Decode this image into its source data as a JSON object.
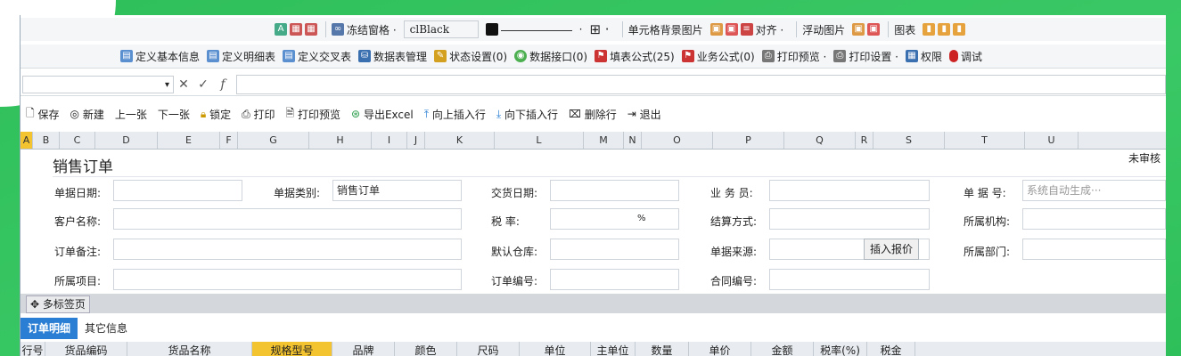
{
  "toolbar1": {
    "freeze_label": "冻结窗格 ·",
    "color_value": "clBlack",
    "cell_bg_label": "单元格背景图片",
    "align_label": "对齐 ·",
    "float_img_label": "浮动图片",
    "chart_label": "图表"
  },
  "toolbar2": {
    "items": [
      "定义基本信息",
      "定义明细表",
      "定义交叉表",
      "数据表管理",
      "状态设置(0)",
      "数据接口(0)",
      "填表公式(25)",
      "业务公式(0)",
      "打印预览 ·",
      "打印设置 ·",
      "权限",
      "调试"
    ]
  },
  "toolbar3": {
    "items": [
      "保存",
      "新建",
      "上一张",
      "下一张",
      "锁定",
      "打印",
      "打印预览",
      "导出Excel",
      "向上插入行",
      "向下插入行",
      "删除行",
      "退出"
    ]
  },
  "columns": [
    "A",
    "B",
    "C",
    "D",
    "E",
    "F",
    "G",
    "H",
    "I",
    "J",
    "K",
    "L",
    "M",
    "N",
    "O",
    "P",
    "Q",
    "R",
    "S",
    "T",
    "U"
  ],
  "form": {
    "title": "销售订单",
    "status": "未审核",
    "doc_date_label": "单据日期:",
    "doc_type_label": "单据类别:",
    "doc_type_value": "销售订单",
    "delivery_date_label": "交货日期:",
    "salesperson_label": "业 务 员:",
    "doc_no_label": "单 据 号:",
    "doc_no_value": "系统自动生成···",
    "customer_label": "客户名称:",
    "tax_rate_label": "税    率:",
    "tax_rate_unit": "%",
    "settlement_label": "结算方式:",
    "org_label": "所属机构:",
    "order_note_label": "订单备注:",
    "warehouse_label": "默认仓库:",
    "source_label": "单据来源:",
    "insert_quote_button": "插入报价",
    "dept_label": "所属部门:",
    "project_label": "所属项目:",
    "order_no_label": "订单编号:",
    "contract_no_label": "合同编号:"
  },
  "sheet_tab": "多标签页",
  "tabs": [
    "订单明细",
    "其它信息"
  ],
  "detail_headers": [
    "行号",
    "货品编码",
    "货品名称",
    "规格型号",
    "品牌",
    "颜色",
    "尺码",
    "单位",
    "主单位",
    "数量",
    "单价",
    "金额",
    "税率(%)",
    "税金"
  ]
}
